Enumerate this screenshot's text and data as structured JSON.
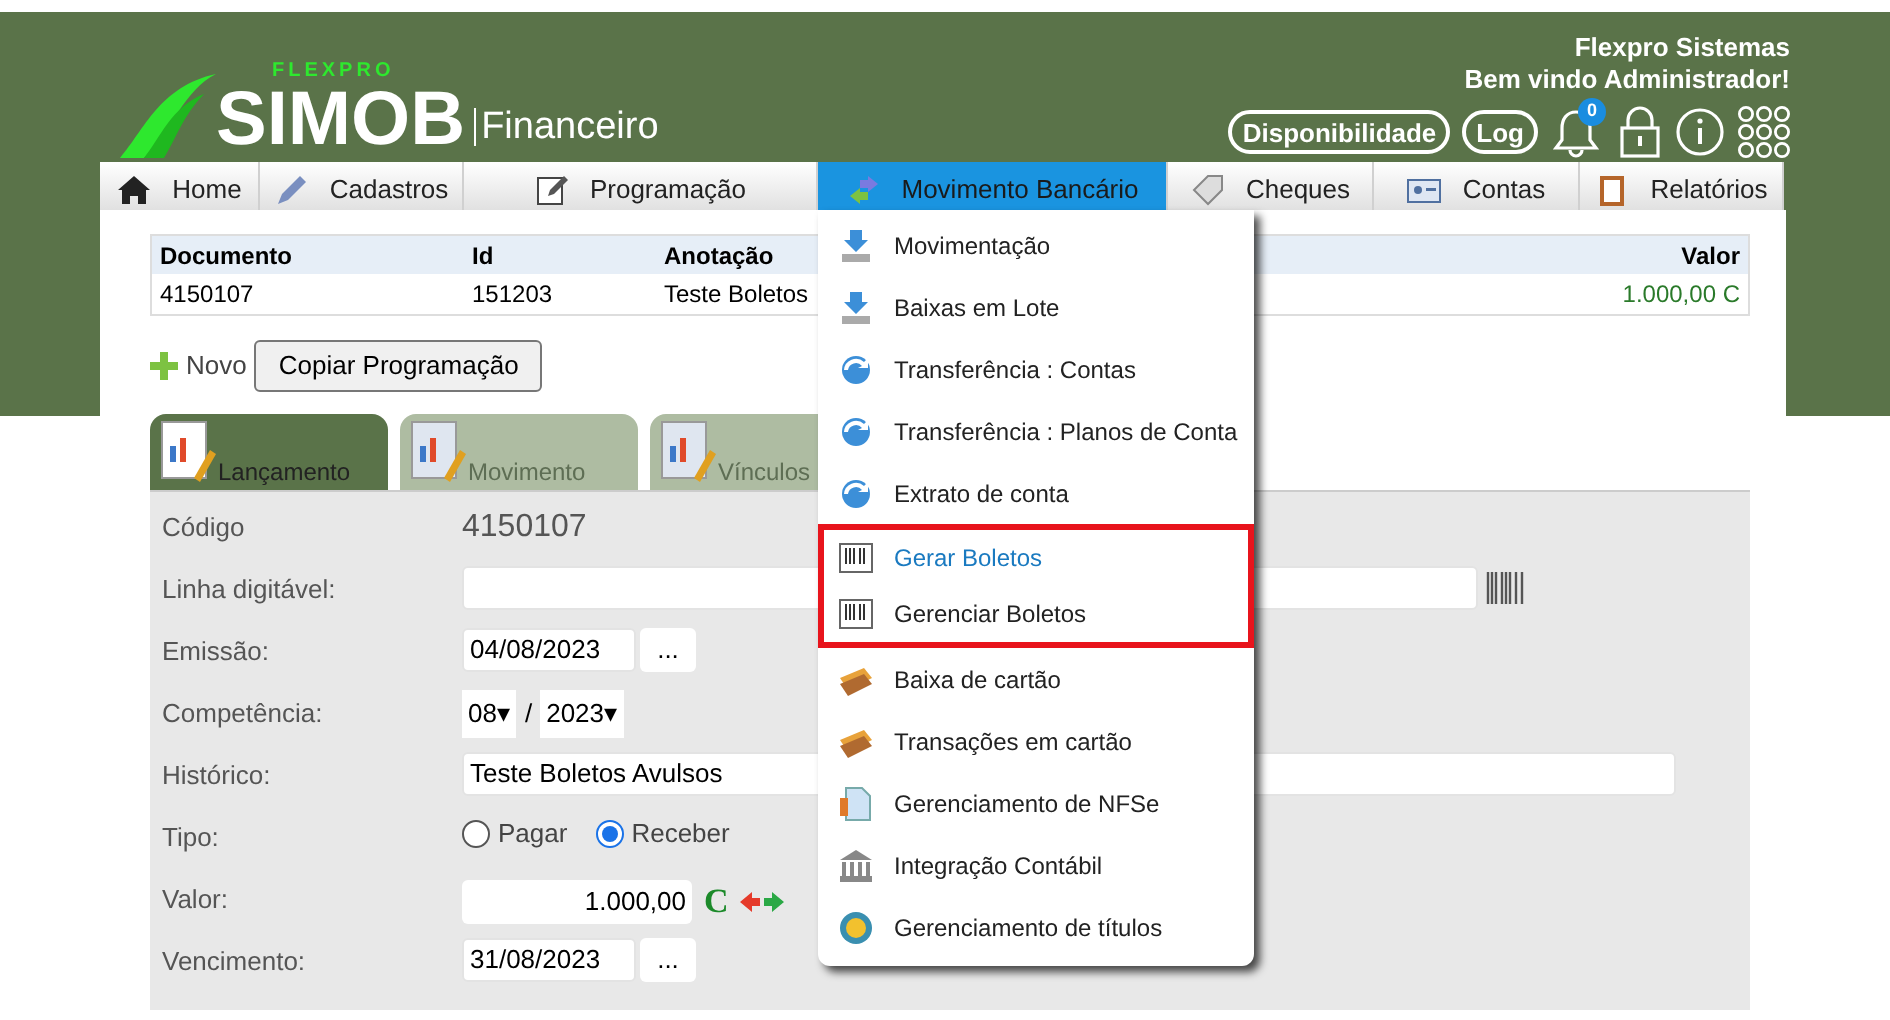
{
  "brand": {
    "tag": "FLEXPRO",
    "name": "SIMOB",
    "module": "Financeiro"
  },
  "user": {
    "company": "Flexpro Sistemas",
    "welcome": "Bem vindo Administrador!"
  },
  "header_buttons": [
    "Disponibilidade",
    "Log"
  ],
  "notifications": {
    "count": "0"
  },
  "nav": [
    {
      "label": "Home",
      "kind": "home",
      "selected": false
    },
    {
      "label": "Cadastros",
      "kind": "pen",
      "selected": false
    },
    {
      "label": "Programação",
      "kind": "edit",
      "selected": false
    },
    {
      "label": "Movimento Bancário",
      "kind": "transfer",
      "selected": true
    },
    {
      "label": "Cheques",
      "kind": "tag",
      "selected": false
    },
    {
      "label": "Contas",
      "kind": "card",
      "selected": false
    },
    {
      "label": "Relatórios",
      "kind": "clipboard",
      "selected": false
    }
  ],
  "table": {
    "columns": [
      "Documento",
      "Id",
      "Anotação",
      "Valor"
    ],
    "rows": [
      [
        "4150107",
        "151203",
        "Teste Boletos",
        "1.000,00 C"
      ]
    ]
  },
  "actions": {
    "new": "Novo",
    "copy": "Copiar Programação"
  },
  "tabs": [
    {
      "label": "Lançamento",
      "selected": true
    },
    {
      "label": "Movimento",
      "selected": false
    },
    {
      "label": "Vínculos",
      "selected": false
    }
  ],
  "form": [
    {
      "kind": "text",
      "label": "Código",
      "value": "4150107"
    },
    {
      "kind": "barcode",
      "label": "Linha digitável:"
    },
    {
      "kind": "date",
      "label": "Emissão:",
      "value": "04/08/2023",
      "button": "..."
    },
    {
      "kind": "period",
      "label": "Competência:",
      "month": "08",
      "separator": "/",
      "year": "2023",
      "arrow": "▾"
    },
    {
      "kind": "wide",
      "label": "Histórico:",
      "value": "Teste Boletos Avulsos"
    },
    {
      "kind": "radio",
      "label": "Tipo:",
      "options": [
        {
          "label": "Pagar",
          "selected": false
        },
        {
          "label": "Receber",
          "selected": true
        }
      ]
    },
    {
      "kind": "amount",
      "label": "Valor:",
      "value": "1.000,00",
      "mark": "C"
    },
    {
      "kind": "date",
      "label": "Vencimento:",
      "value": "31/08/2023",
      "button": "..."
    }
  ],
  "menu": [
    {
      "label": "Movimentação",
      "kind": "download",
      "hovered": false,
      "highlighted": false
    },
    {
      "label": "Baixas em Lote",
      "kind": "download",
      "hovered": false,
      "highlighted": false
    },
    {
      "label": "Transferência : Contas",
      "kind": "sync",
      "hovered": false,
      "highlighted": false
    },
    {
      "label": "Transferência : Planos de Conta",
      "kind": "sync",
      "hovered": false,
      "highlighted": false
    },
    {
      "label": "Extrato de conta",
      "kind": "sync",
      "hovered": false,
      "highlighted": false
    },
    {
      "label": "Gerar Boletos",
      "kind": "barcode",
      "hovered": true,
      "highlighted": true
    },
    {
      "label": "Gerenciar Boletos",
      "kind": "barcode",
      "hovered": false,
      "highlighted": true
    },
    {
      "label": "Baixa de cartão",
      "kind": "cards",
      "hovered": false,
      "highlighted": false
    },
    {
      "label": "Transações em cartão",
      "kind": "cards",
      "hovered": false,
      "highlighted": false
    },
    {
      "label": "Gerenciamento de NFSe",
      "kind": "doc",
      "hovered": false,
      "highlighted": false
    },
    {
      "label": "Integração Contábil",
      "kind": "bank",
      "hovered": false,
      "highlighted": false
    },
    {
      "label": "Gerenciamento de títulos",
      "kind": "coin",
      "hovered": false,
      "highlighted": false
    }
  ]
}
